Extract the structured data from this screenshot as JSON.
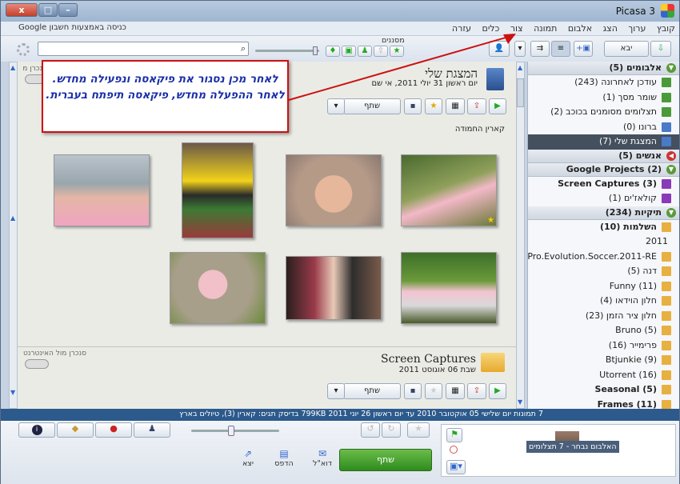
{
  "window": {
    "title": "Picasa 3",
    "controls": [
      "x",
      "□",
      "–"
    ]
  },
  "menu": {
    "items": [
      "קובץ",
      "ערוך",
      "הצג",
      "אלבום",
      "תמונה",
      "צור",
      "כלים",
      "עזרה"
    ],
    "signin": "כניסה באמצעות חשבון Google"
  },
  "toolbar": {
    "import_label": "יבא",
    "filter_label": "מסננים"
  },
  "callout": {
    "text": "לאחר מכן נסגור את פיקאסה ונפעילה מחדש. לאחר ההפעלה מחדש, פיקאסה תיפתח בעברית."
  },
  "album1": {
    "title": "המצגת שלי",
    "date": "יום ראשון 31 יולי 2011, אי שם",
    "share": "שתף",
    "caption": "קארין החמודה",
    "sync": "סנכרן מול האינטרנט"
  },
  "album2": {
    "title": "Screen Captures",
    "date": "שבת 06 אוגוסט 2011",
    "share": "שתף",
    "sync": "סנכרן מול האינטרנט"
  },
  "sidebar": {
    "albums_header": "אלבומים (5)",
    "albums": [
      "עודכן לאחרונה (243)",
      "שומר מסך (1)",
      "תצלומים מסומנים בכוכב (2)",
      "ברונו (0)",
      "המצגת שלי (7)"
    ],
    "people_header": "אנשים (5)",
    "projects_header": "Google Projects (2)",
    "projects": [
      "Screen Captures (3)",
      "קולאז'ים (1)"
    ],
    "folders_header": "תיקיות (234)",
    "folders": [
      "השלמות (10)",
      "2011",
      "Pro.Evolution.Soccer.2011-RE...",
      "דנה (5)",
      "Funny (11)",
      "חלון הוידאו (4)",
      "חלון ציר הזמן (23)",
      "Bruno (5)",
      "פרימייר (16)",
      "Btjunkie (9)",
      "Utorrent (16)",
      "Seasonal (5)",
      "Frames (11)"
    ]
  },
  "status": {
    "text": "7 תמונות  יום שלישי 05 אוקטובר 2010 עד יום ראשון 26 יוני 2011  799KB בדיסק  תגים: קארין (3), טיולים בארץ"
  },
  "bottom": {
    "share_label": "שתף",
    "email": "דוא\"ל",
    "print": "הדפס",
    "export": "יצא",
    "tray_label": "האלבום נבחר - 7 תצלומים"
  }
}
